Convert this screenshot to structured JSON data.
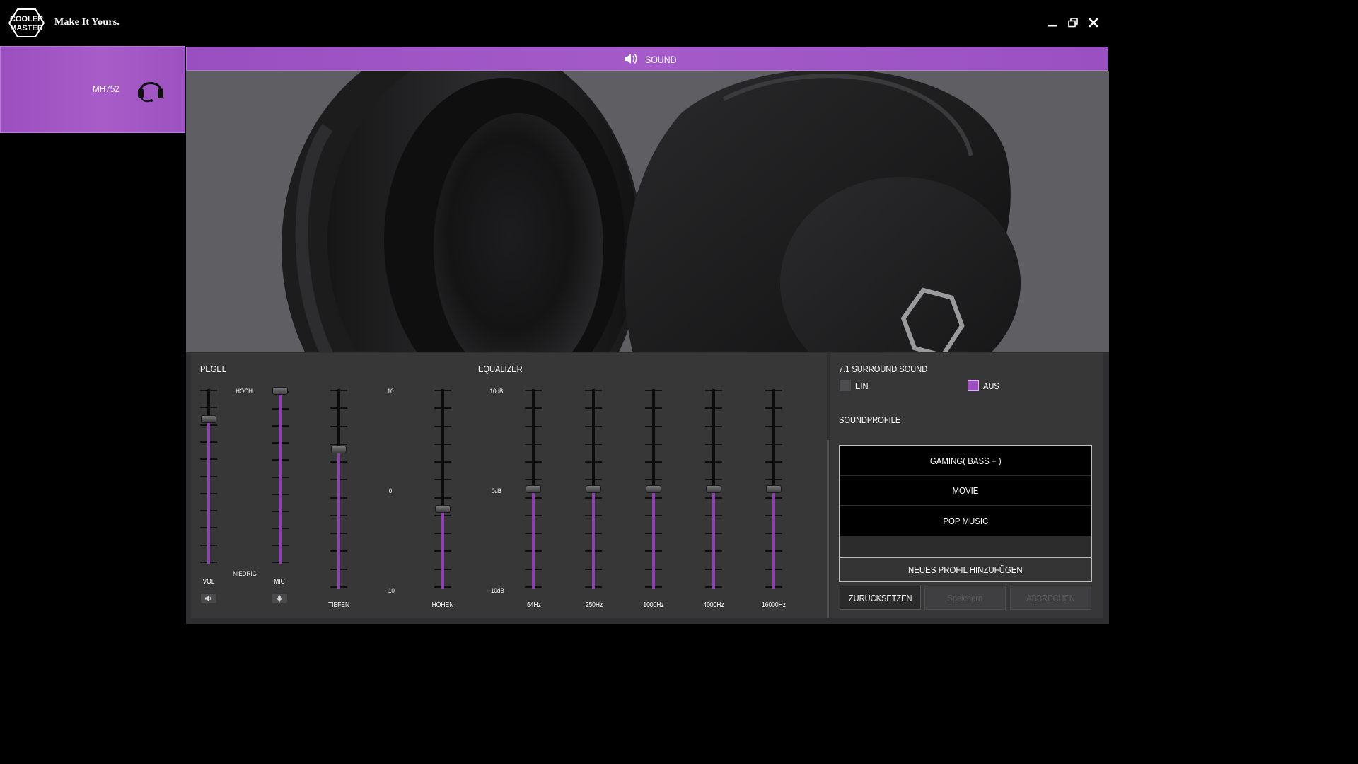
{
  "app": {
    "logo_text": [
      "COOLER",
      "MASTER"
    ],
    "tagline": "Make It Yours."
  },
  "device": {
    "name": "MH752",
    "icon": "headset-icon"
  },
  "header": {
    "title": "SOUND",
    "icon": "speaker-icon"
  },
  "pegel": {
    "title": "PEGEL",
    "hoch": "HOCH",
    "niedrig": "NIEDRIG",
    "vol_label": "VOL",
    "mic_label": "MIC",
    "vol_level": 0.83,
    "mic_level": 1.0,
    "vol_icon": "speaker-icon",
    "mic_icon": "microphone-icon"
  },
  "tone": {
    "scale_top": "10",
    "scale_mid": "0",
    "scale_bottom": "-10",
    "tiefen_label": "TIEFEN",
    "hoehen_label": "HÖHEN",
    "tiefen_value": 4,
    "hoehen_value": -2
  },
  "equalizer": {
    "title": "EQUALIZER",
    "scale_top": "10dB",
    "scale_mid": "0dB",
    "scale_bottom": "-10dB",
    "bands": [
      {
        "label": "64Hz",
        "value": 0
      },
      {
        "label": "250Hz",
        "value": 0
      },
      {
        "label": "1000Hz",
        "value": 0
      },
      {
        "label": "4000Hz",
        "value": 0
      },
      {
        "label": "16000Hz",
        "value": 0
      }
    ]
  },
  "surround": {
    "title": "7.1 SURROUND SOUND",
    "on_label": "EIN",
    "off_label": "AUS",
    "selected": "AUS"
  },
  "profiles": {
    "title": "SOUNDPROFILE",
    "items": [
      "GAMING( BASS + )",
      "MOVIE",
      "POP MUSIC"
    ],
    "add_label": "NEUES PROFIL HINZUFÜGEN"
  },
  "actions": {
    "reset": "ZURÜCKSETZEN",
    "save": "Speichern",
    "cancel": "ABBRECHEN"
  },
  "colors": {
    "accent": "#9b4fc0",
    "fill": "#8e3fb3",
    "panel": "#373738"
  }
}
